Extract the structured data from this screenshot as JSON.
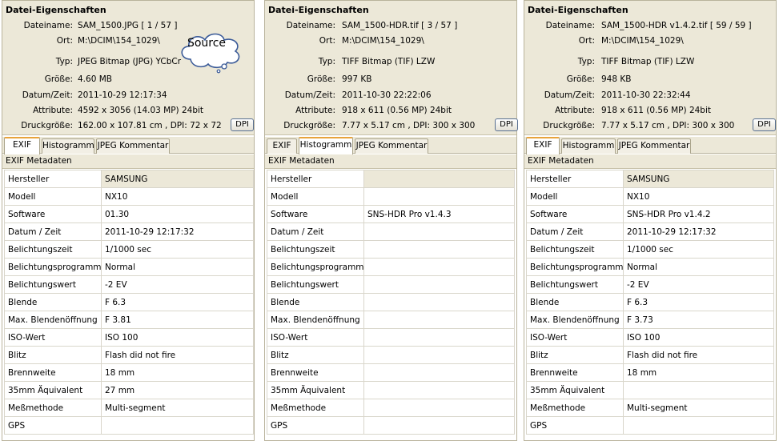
{
  "panels": [
    {
      "props_title": "Datei-Eigenschaften",
      "props": [
        {
          "label": "Dateiname:",
          "value": "SAM_1500.JPG   [ 1 / 57 ]"
        },
        {
          "label": "Ort:",
          "value": "M:\\DCIM\\154_1029\\"
        },
        {
          "label": "Typ:",
          "value": "JPEG Bitmap (JPG) YCbCr"
        },
        {
          "label": "Größe:",
          "value": "4.60 MB"
        },
        {
          "label": "Datum/Zeit:",
          "value": "2011-10-29 12:17:34"
        },
        {
          "label": "Attribute:",
          "value": "4592 x 3056 (14.03 MP)  24bit"
        },
        {
          "label": "Druckgröße:",
          "value": "162.00 x 107.81 cm ,  DPI: 72 x 72"
        }
      ],
      "dpi_label": "DPI",
      "tabs": [
        "EXIF",
        "Histogramm",
        "JPEG Kommentar"
      ],
      "active_tab": 0,
      "meta_title": "EXIF Metadaten",
      "rows": [
        [
          "Hersteller",
          "SAMSUNG"
        ],
        [
          "Modell",
          "NX10"
        ],
        [
          "Software",
          "01.30"
        ],
        [
          "Datum / Zeit",
          "2011-10-29 12:17:32"
        ],
        [
          "Belichtungszeit",
          "1/1000 sec"
        ],
        [
          "Belichtungsprogramm",
          "Normal"
        ],
        [
          "Belichtungswert",
          "-2 EV"
        ],
        [
          "Blende",
          "F 6.3"
        ],
        [
          "Max. Blendenöffnung",
          "F 3.81"
        ],
        [
          "ISO-Wert",
          "ISO 100"
        ],
        [
          "Blitz",
          "Flash did not fire"
        ],
        [
          "Brennweite",
          "18 mm"
        ],
        [
          "35mm Äquivalent",
          "27 mm"
        ],
        [
          "Meßmethode",
          "Multi-segment"
        ],
        [
          "GPS",
          ""
        ]
      ]
    },
    {
      "props_title": "Datei-Eigenschaften",
      "props": [
        {
          "label": "Dateiname:",
          "value": "SAM_1500-HDR.tif   [ 3 / 57 ]"
        },
        {
          "label": "Ort:",
          "value": "M:\\DCIM\\154_1029\\"
        },
        {
          "label": "Typ:",
          "value": "TIFF Bitmap (TIF) LZW"
        },
        {
          "label": "Größe:",
          "value": "997 KB"
        },
        {
          "label": "Datum/Zeit:",
          "value": "2011-10-30 22:22:06"
        },
        {
          "label": "Attribute:",
          "value": "918 x 611 (0.56 MP)  24bit"
        },
        {
          "label": "Druckgröße:",
          "value": "7.77 x 5.17 cm ,  DPI: 300 x 300"
        }
      ],
      "dpi_label": "DPI",
      "tabs": [
        "EXIF",
        "Histogramm",
        "JPEG Kommentar"
      ],
      "active_tab": 1,
      "meta_title": "EXIF Metadaten",
      "rows": [
        [
          "Hersteller",
          ""
        ],
        [
          "Modell",
          ""
        ],
        [
          "Software",
          "SNS-HDR Pro v1.4.3"
        ],
        [
          "Datum / Zeit",
          ""
        ],
        [
          "Belichtungszeit",
          ""
        ],
        [
          "Belichtungsprogramm",
          ""
        ],
        [
          "Belichtungswert",
          ""
        ],
        [
          "Blende",
          ""
        ],
        [
          "Max. Blendenöffnung",
          ""
        ],
        [
          "ISO-Wert",
          ""
        ],
        [
          "Blitz",
          ""
        ],
        [
          "Brennweite",
          ""
        ],
        [
          "35mm Äquivalent",
          ""
        ],
        [
          "Meßmethode",
          ""
        ],
        [
          "GPS",
          ""
        ]
      ]
    },
    {
      "props_title": "Datei-Eigenschaften",
      "props": [
        {
          "label": "Dateiname:",
          "value": "SAM_1500-HDR v1.4.2.tif   [ 59 / 59 ]"
        },
        {
          "label": "Ort:",
          "value": "M:\\DCIM\\154_1029\\"
        },
        {
          "label": "Typ:",
          "value": "TIFF Bitmap (TIF) LZW"
        },
        {
          "label": "Größe:",
          "value": "948 KB"
        },
        {
          "label": "Datum/Zeit:",
          "value": "2011-10-30 22:32:44"
        },
        {
          "label": "Attribute:",
          "value": "918 x 611 (0.56 MP)  24bit"
        },
        {
          "label": "Druckgröße:",
          "value": "7.77 x 5.17 cm ,  DPI: 300 x 300"
        }
      ],
      "dpi_label": "DPI",
      "tabs": [
        "EXIF",
        "Histogramm",
        "JPEG Kommentar"
      ],
      "active_tab": 0,
      "meta_title": "EXIF Metadaten",
      "rows": [
        [
          "Hersteller",
          "SAMSUNG"
        ],
        [
          "Modell",
          "NX10"
        ],
        [
          "Software",
          "SNS-HDR Pro v1.4.2"
        ],
        [
          "Datum / Zeit",
          "2011-10-29 12:17:32"
        ],
        [
          "Belichtungszeit",
          "1/1000 sec"
        ],
        [
          "Belichtungsprogramm",
          "Normal"
        ],
        [
          "Belichtungswert",
          "-2 EV"
        ],
        [
          "Blende",
          "F 6.3"
        ],
        [
          "Max. Blendenöffnung",
          "F 3.73"
        ],
        [
          "ISO-Wert",
          "ISO 100"
        ],
        [
          "Blitz",
          "Flash did not fire"
        ],
        [
          "Brennweite",
          "18 mm"
        ],
        [
          "35mm Äquivalent",
          ""
        ],
        [
          "Meßmethode",
          "Multi-segment"
        ],
        [
          "GPS",
          ""
        ]
      ]
    }
  ],
  "annotation": {
    "text": "Source"
  },
  "colors": {
    "panel_bg": "#ece8d8",
    "active_tab_accent": "#e8a33b",
    "grid": "#d9d6cb"
  }
}
